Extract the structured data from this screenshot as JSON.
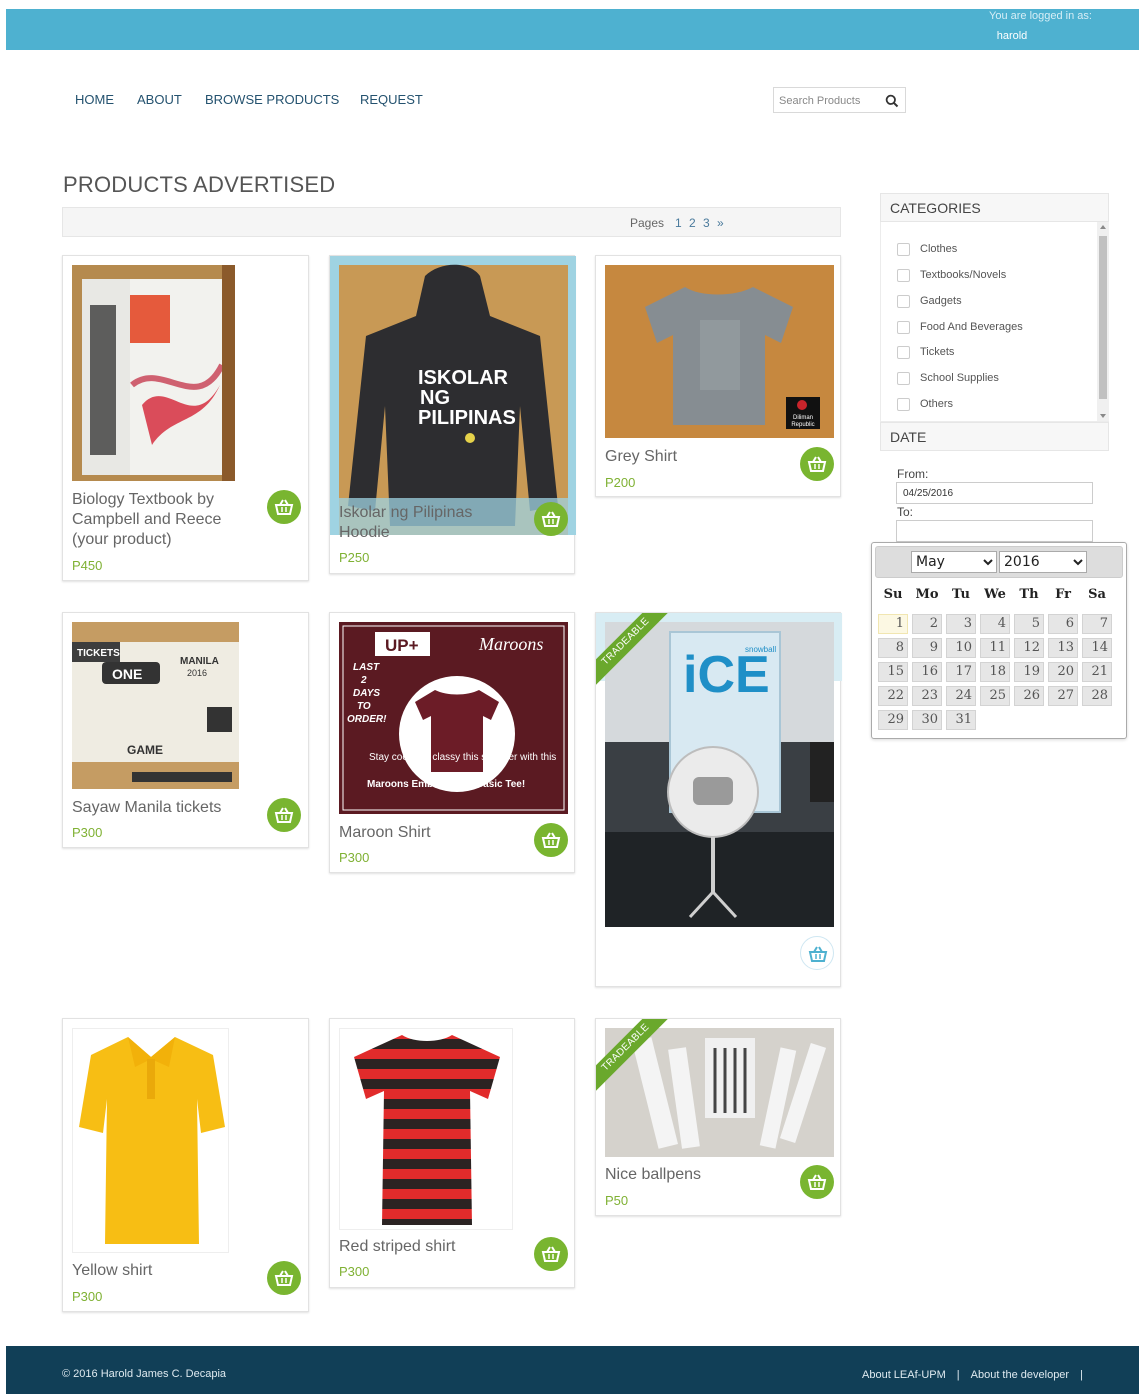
{
  "header": {
    "logged_in_label": "You are logged in as:",
    "username": "harold"
  },
  "nav": {
    "items": [
      "HOME",
      "ABOUT",
      "BROWSE PRODUCTS",
      "REQUEST"
    ]
  },
  "search": {
    "placeholder": "Search Products",
    "icon": "search-icon"
  },
  "main": {
    "title": "PRODUCTS ADVERTISED",
    "pages_label": "Pages",
    "pages": [
      "1",
      "2",
      "3",
      "»"
    ]
  },
  "products": [
    {
      "name": "Biology Textbook by Campbell and Reece (your product)",
      "price": "P450",
      "tradeable": false,
      "image": "biology-textbook"
    },
    {
      "name": "Iskolar ng Pilipinas Hoodie",
      "price": "P250",
      "tradeable": false,
      "image": "hoodie",
      "image_text": [
        "ISKOLAR",
        "NG",
        "PILIPINAS"
      ]
    },
    {
      "name": "Grey Shirt",
      "price": "P200",
      "tradeable": false,
      "image": "grey-shirt",
      "image_text": [
        "Diliman",
        "Republic"
      ]
    },
    {
      "name": "Sayaw Manila tickets",
      "price": "P300",
      "tradeable": false,
      "image": "tickets",
      "image_text": [
        "TICKETS",
        "MANILA",
        "2016",
        "ONE",
        "GAME"
      ]
    },
    {
      "name": "Maroon Shirt",
      "price": "P300",
      "tradeable": false,
      "image": "maroon-shirt",
      "image_text": [
        "UP+",
        "Maroons",
        "LAST",
        "2",
        "DAYS",
        "TO",
        "ORDER!",
        "Stay cool and classy this summer with this",
        "Maroons Embroidered Basic Tee!"
      ]
    },
    {
      "name": "",
      "price": "",
      "tradeable": true,
      "image": "snowball-mic",
      "image_text": [
        "iCE",
        "snowball"
      ]
    },
    {
      "name": "Yellow shirt",
      "price": "P300",
      "tradeable": false,
      "image": "yellow-polo"
    },
    {
      "name": "Red striped shirt",
      "price": "P300",
      "tradeable": false,
      "image": "striped-shirt"
    },
    {
      "name": "Nice ballpens",
      "price": "P50",
      "tradeable": true,
      "image": "ballpens"
    }
  ],
  "ribbon_label": "TRADEABLE",
  "sidebar": {
    "categories_title": "CATEGORIES",
    "categories": [
      "Clothes",
      "Textbooks/Novels",
      "Gadgets",
      "Food And Beverages",
      "Tickets",
      "School Supplies",
      "Others"
    ],
    "date_title": "DATE",
    "from_label": "From:",
    "from_value": "04/25/2016",
    "to_label": "To:",
    "to_value": ""
  },
  "calendar": {
    "month": "May",
    "year": "2016",
    "weekdays": [
      "Su",
      "Mo",
      "Tu",
      "We",
      "Th",
      "Fr",
      "Sa"
    ],
    "days": [
      "1",
      "2",
      "3",
      "4",
      "5",
      "6",
      "7",
      "8",
      "9",
      "10",
      "11",
      "12",
      "13",
      "14",
      "15",
      "16",
      "17",
      "18",
      "19",
      "20",
      "21",
      "22",
      "23",
      "24",
      "25",
      "26",
      "27",
      "28",
      "29",
      "30",
      "31"
    ],
    "highlighted_day": "1"
  },
  "footer": {
    "copyright": "© 2016 Harold James C. Decapia",
    "link1": "About LEAf-UPM",
    "link2": "About the developer",
    "separator": "|"
  },
  "colors": {
    "topbar": "#4eb1d0",
    "footer": "#113f57",
    "price": "#7fb133",
    "basket": "#79b530",
    "ribbon": "#6aa82c"
  }
}
